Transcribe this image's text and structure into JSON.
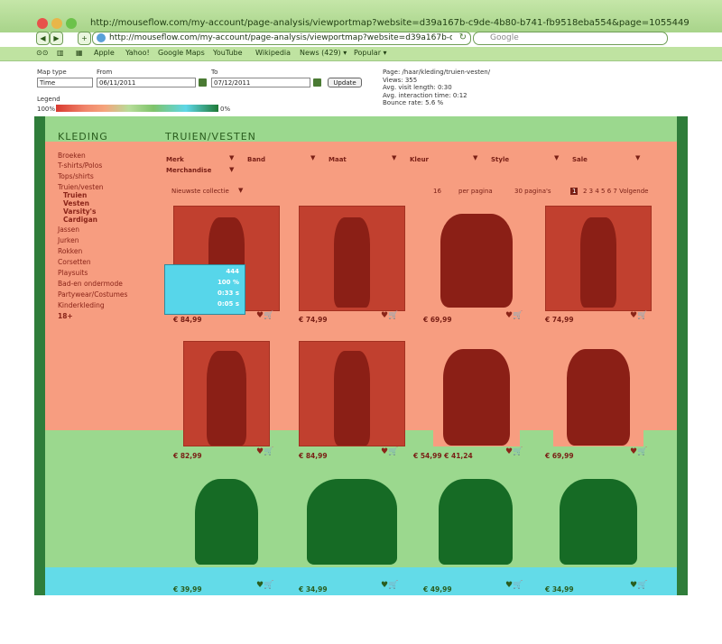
{
  "browser": {
    "title": "http://mouseflow.com/my-account/page-analysis/viewportmap?website=d39a167b-c9de-4b80-b741-fb9518eba554&page=1055449",
    "address": "http://mouseflow.com/my-account/page-analysis/viewportmap?website=d39a167b-c9de-4b",
    "search_placeholder": "Google",
    "bookmarks": [
      "Apple",
      "Yahoo!",
      "Google Maps",
      "YouTube",
      "Wikipedia",
      "News (429) ▾",
      "Popular ▾"
    ]
  },
  "controls": {
    "map_type_label": "Map type",
    "map_type_value": "Time",
    "from_label": "From",
    "from_value": "06/11/2011",
    "to_label": "To",
    "to_value": "07/12/2011",
    "update_label": "Update",
    "legend_label": "Legend",
    "legend_left": "100%",
    "legend_right": "0%"
  },
  "stats": {
    "page": "Page: /haar/kleding/truien-vesten/",
    "views": "Views: 355",
    "avg_visit": "Avg. visit length: 0:30",
    "avg_interaction": "Avg. interaction time: 0:12",
    "bounce": "Bounce rate: 5.6 %"
  },
  "site": {
    "sidebar_title": "KLEDING",
    "page_title": "TRUIEN/VESTEN",
    "categories": [
      "Broeken",
      "T-shirts/Polos",
      "Tops/shirts",
      "Truien/vesten"
    ],
    "subcategories": [
      "Truien",
      "Vesten",
      "Varsity's",
      "Cardigan"
    ],
    "more_categories": [
      "Jassen",
      "Jurken",
      "Rokken",
      "Corsetten",
      "Playsuits",
      "Bad-en ondermode",
      "Partywear/Costumes",
      "Kinderkleding",
      "18+"
    ],
    "filters": [
      "Merk",
      "Band",
      "Maat",
      "Kleur",
      "Style",
      "Sale",
      "Merchandise"
    ],
    "sort": "Nieuwste collectie",
    "per_page_count": "16",
    "per_page_label": "per pagina",
    "pages_label": "30 pagina's",
    "current_page": "1",
    "pages_rest": "2 3 4 5 6 7 Volgende"
  },
  "tooltip": {
    "values": [
      "444",
      "100 %",
      "0:33 s",
      "0:05 s"
    ]
  },
  "products": [
    {
      "price": "€ 84,99"
    },
    {
      "price": "€ 74,99"
    },
    {
      "price": "€ 69,99"
    },
    {
      "price": "€ 74,99"
    },
    {
      "price": "€ 82,99"
    },
    {
      "price": "€ 84,99"
    },
    {
      "price": "€ 54,99 € 41,24"
    },
    {
      "price": "€ 69,99"
    },
    {
      "price": "€ 39,99"
    },
    {
      "price": "€ 34,99"
    },
    {
      "price": "€ 49,99"
    },
    {
      "price": "€ 34,99"
    }
  ],
  "colors": {
    "hot": "#f79d80",
    "warm": "#9bd88e",
    "cool": "#63dbe8",
    "edge": "#2f7d3a"
  }
}
